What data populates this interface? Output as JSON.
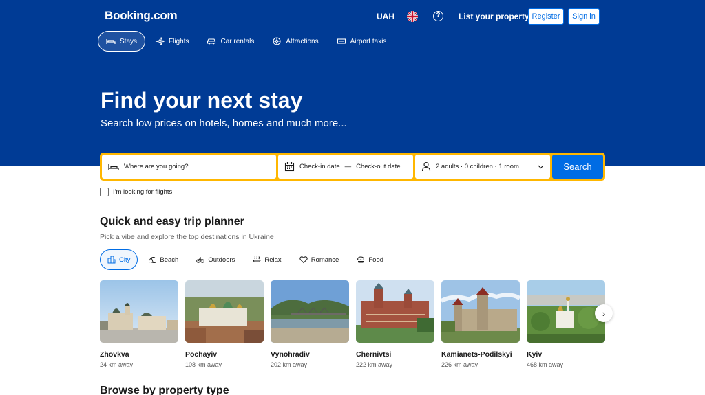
{
  "header": {
    "logo": "Booking.com",
    "currency": "UAH",
    "help_icon": "?",
    "list_property": "List your property",
    "register": "Register",
    "sign_in": "Sign in",
    "flag_icon": "uk-flag-icon"
  },
  "nav": {
    "items": [
      {
        "label": "Stays",
        "icon": "bed-icon",
        "active": true
      },
      {
        "label": "Flights",
        "icon": "plane-icon"
      },
      {
        "label": "Car rentals",
        "icon": "car-icon"
      },
      {
        "label": "Attractions",
        "icon": "attractions-icon"
      },
      {
        "label": "Airport taxis",
        "icon": "taxi-icon"
      }
    ]
  },
  "hero": {
    "title": "Find your next stay",
    "subtitle": "Search low prices on hotels, homes and much more..."
  },
  "search": {
    "destination_placeholder": "Where are you going?",
    "checkin": "Check-in date",
    "date_sep": "—",
    "checkout": "Check-out date",
    "occupancy": "2 adults · 0 children · 1 room",
    "button": "Search",
    "flights_checkbox": "I'm looking for flights"
  },
  "planner": {
    "title": "Quick and easy trip planner",
    "subtitle": "Pick a vibe and explore the top destinations in Ukraine",
    "chips": [
      {
        "label": "City",
        "icon": "city-icon",
        "active": true
      },
      {
        "label": "Beach",
        "icon": "beach-icon"
      },
      {
        "label": "Outdoors",
        "icon": "bike-icon"
      },
      {
        "label": "Relax",
        "icon": "relax-icon"
      },
      {
        "label": "Romance",
        "icon": "heart-icon"
      },
      {
        "label": "Food",
        "icon": "food-icon"
      }
    ],
    "destinations": [
      {
        "name": "Zhovkva",
        "distance": "24 km away"
      },
      {
        "name": "Pochayiv",
        "distance": "108 km away"
      },
      {
        "name": "Vynohradiv",
        "distance": "202 km away"
      },
      {
        "name": "Chernivtsi",
        "distance": "222 km away"
      },
      {
        "name": "Kamianets-Podilskyi",
        "distance": "226 km away"
      },
      {
        "name": "Kyiv",
        "distance": "468 km away"
      }
    ],
    "next_icon": "›"
  },
  "browse": {
    "title": "Browse by property type"
  },
  "colors": {
    "brand_blue": "#003b95",
    "accent_blue": "#006ce4",
    "search_border": "#ffb700"
  }
}
